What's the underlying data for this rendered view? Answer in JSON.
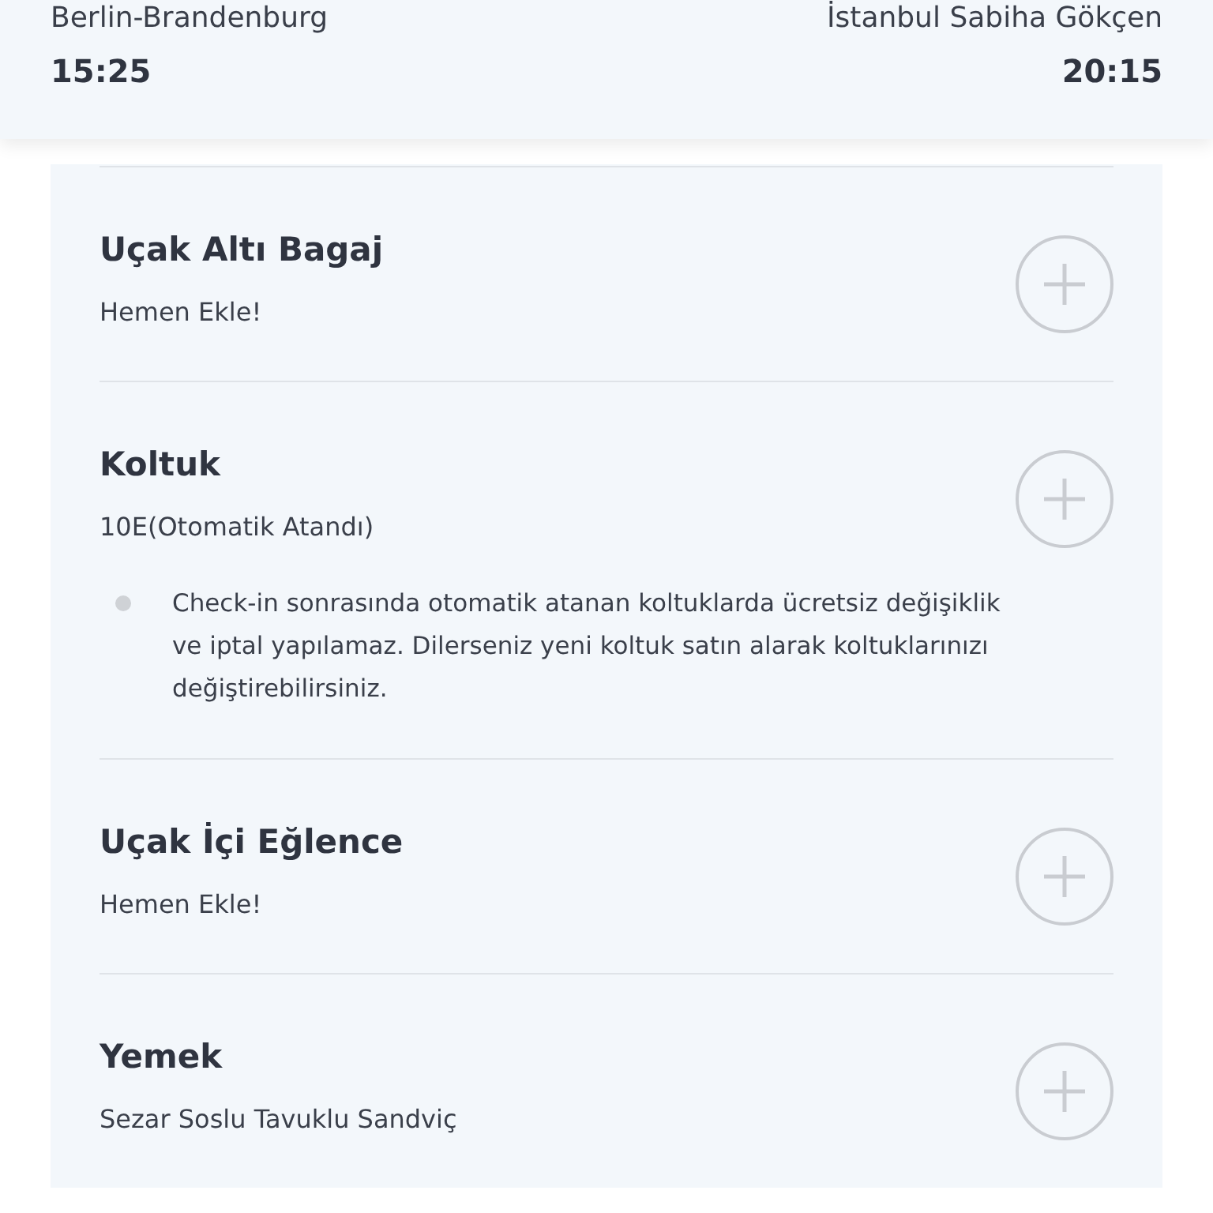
{
  "flight": {
    "departure": {
      "airport": "Berlin-Brandenburg",
      "time": "15:25"
    },
    "arrival": {
      "airport": "İstanbul Sabiha Gökçen",
      "time": "20:15"
    }
  },
  "services": [
    {
      "title": "Uçak Altı Bagaj",
      "subtitle": "Hemen Ekle!"
    },
    {
      "title": "Koltuk",
      "subtitle": "10E(Otomatik Atandı)",
      "notes": [
        "Check-in sonrasında otomatik atanan koltuklarda ücretsiz değişiklik ve iptal yapılamaz. Dilerseniz yeni koltuk satın alarak koltuklarınızı değiştirebilirsiniz."
      ]
    },
    {
      "title": "Uçak İçi Eğlence",
      "subtitle": "Hemen Ekle!"
    },
    {
      "title": "Yemek",
      "subtitle": "Sezar Soslu Tavuklu Sandviç"
    }
  ]
}
